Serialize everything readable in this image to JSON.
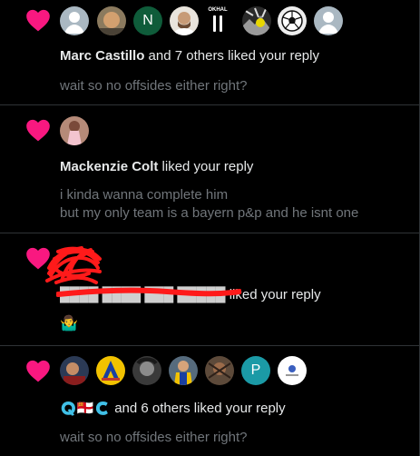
{
  "notifications": [
    {
      "actor": "Marc Castillo",
      "rest": " and 7 others liked your reply",
      "reply": "wait so no offsides either right?",
      "avatars": [
        "avatar-grey-default",
        "avatar-photo-child",
        "N",
        "avatar-photo-man-beard",
        "avatar-kabal-logo",
        "avatar-bw-photo-group",
        "avatar-soccer-ball",
        "avatar-grey-default-2"
      ]
    },
    {
      "actor": "Mackenzie Colt",
      "rest": " liked your reply",
      "reply_lines": [
        "i kinda wanna complete him",
        "but my only team is a bayern p&p and he isnt one"
      ]
    },
    {
      "actor_redacted": "████ ████ ███ █████",
      "rest": " liked your reply",
      "reply": "🤷‍♂️"
    },
    {
      "actor": "🇶🇨🇶🇨",
      "rest": " and 6 others liked your reply",
      "reply": "wait so no offsides either right?",
      "avatars": [
        "avatar-photo-1",
        "avatar-letter-a-logo",
        "avatar-bw-photo",
        "avatar-photo-player",
        "avatar-photo-2",
        "P",
        "avatar-white-logo"
      ]
    }
  ],
  "colors": {
    "heart": "#f91880",
    "muted": "#71767b",
    "divider": "#2f3336",
    "green_avatar": "#0f5c3a",
    "teal_avatar": "#1b9aa6",
    "redact": "#ff1a1a"
  },
  "icons": {
    "heart": "heart-icon"
  }
}
